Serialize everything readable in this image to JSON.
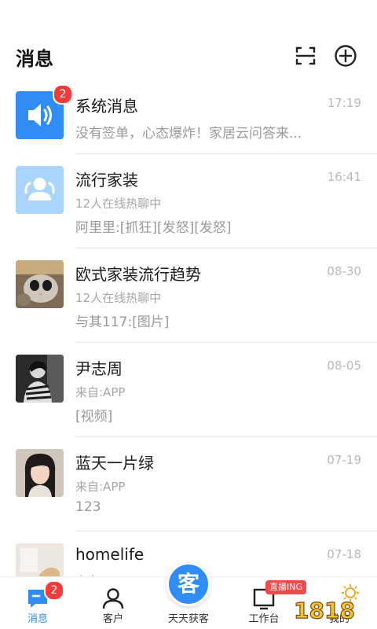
{
  "header": {
    "title": "消息",
    "scan_icon": "scan-icon",
    "add_icon": "plus-circle-icon"
  },
  "messages": [
    {
      "name": "系统消息",
      "time": "17:19",
      "badge": "2",
      "preview": "没有签单，心态爆炸！家居云问答来...",
      "avatar_icon": "speaker-icon",
      "avatar_color": "#2f8df5"
    },
    {
      "name": "流行家装",
      "time": "16:41",
      "sub": "12人在线热聊中",
      "preview": "阿里里:[抓狂][发怒][发怒]",
      "avatar_icon": "group-icon",
      "avatar_color": "#a9d4fb"
    },
    {
      "name": "欧式家装流行趋势",
      "time": "08-30",
      "sub": "12人在线热聊中",
      "preview": "与其117:[图片]",
      "avatar_icon": "cat-photo"
    },
    {
      "name": "尹志周",
      "time": "08-05",
      "sub": "来自:APP",
      "preview": "[视频]",
      "avatar_icon": "person-photo"
    },
    {
      "name": "蓝天一片绿",
      "time": "07-19",
      "sub": "来自:APP",
      "preview": "123",
      "avatar_icon": "woman-photo"
    },
    {
      "name": "homelife",
      "time": "07-18",
      "sub": "来自:APP",
      "avatar_icon": "room-photo"
    }
  ],
  "tabbar": {
    "items": [
      {
        "label": "消息",
        "icon": "chat-icon",
        "badge": "2",
        "active": true
      },
      {
        "label": "客户",
        "icon": "person-icon"
      },
      {
        "label": "天天获客",
        "icon": "ke-button"
      },
      {
        "label": "工作台",
        "icon": "workbench-icon"
      },
      {
        "label": "我的",
        "icon": "me-icon"
      }
    ],
    "center_text": "客",
    "live_tag": "直播ING"
  },
  "watermark": "1818",
  "colors": {
    "accent": "#2f8df5",
    "badge": "#f23b3b",
    "live": "#f04a4a"
  }
}
